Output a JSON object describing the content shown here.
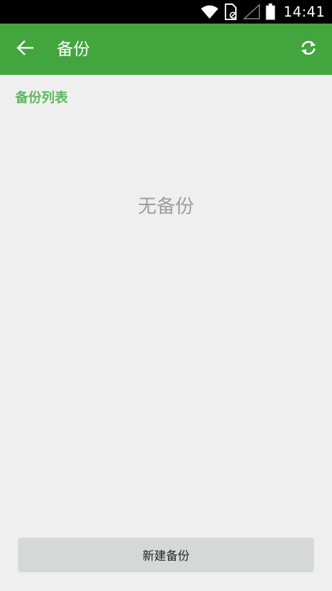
{
  "status_bar": {
    "time": "14:41",
    "icons": [
      "wifi-icon",
      "sim-card-icon",
      "cell-signal-icon",
      "battery-icon"
    ]
  },
  "app_bar": {
    "title": "备份",
    "back_icon": "arrow-left-icon",
    "refresh_icon": "refresh-icon",
    "background_color": "#43a53d"
  },
  "backup_list": {
    "section_title": "备份列表",
    "empty_text": "无备份",
    "accent_color": "#5cb85a"
  },
  "actions": {
    "new_backup_label": "新建备份"
  }
}
